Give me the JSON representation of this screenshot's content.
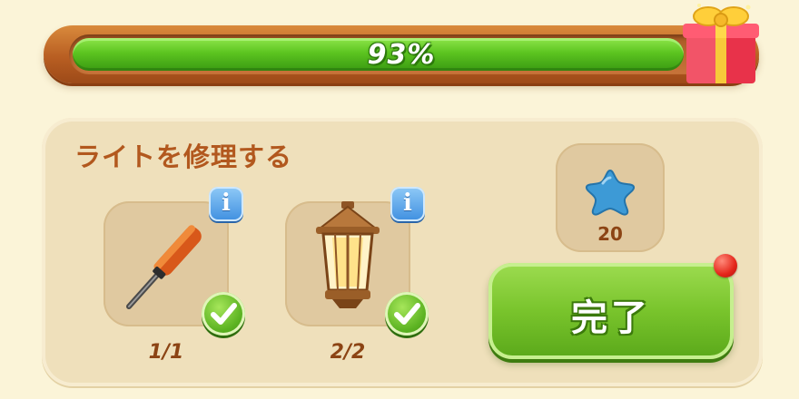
{
  "progress": {
    "percent_label": "93%",
    "value": 0.93
  },
  "task": {
    "title": "ライトを修理する",
    "items": [
      {
        "name": "screwdriver",
        "count_label": "1/1",
        "completed": true
      },
      {
        "name": "lantern",
        "count_label": "2/2",
        "completed": true
      }
    ],
    "reward": {
      "icon": "blue-star-icon",
      "amount": "20"
    },
    "complete_button_label": "完了"
  },
  "colors": {
    "progress_fill": "#5cc420",
    "title_text": "#b2581e",
    "complete_button": "#79c42c",
    "notification": "#e4261a",
    "info_badge": "#3f8fe0"
  }
}
